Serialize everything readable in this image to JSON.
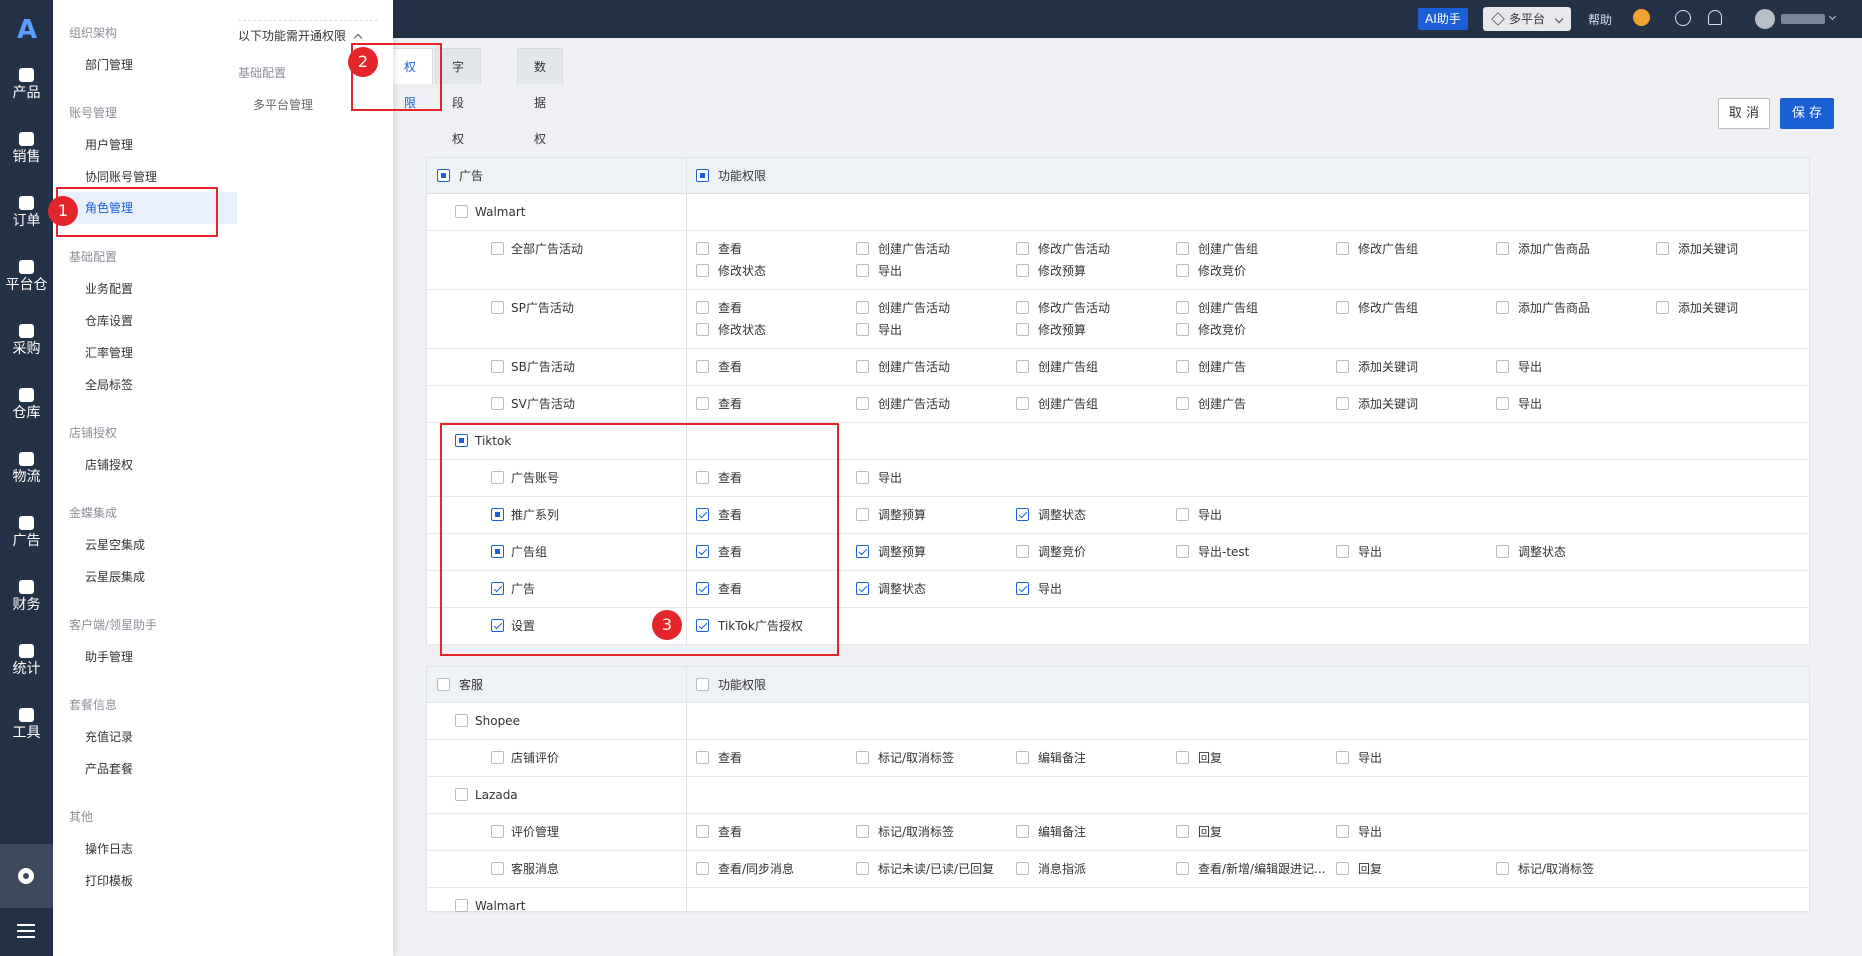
{
  "app": {
    "logo": "A"
  },
  "rail": {
    "items": [
      {
        "label": "产品",
        "icon": "product-icon"
      },
      {
        "label": "销售",
        "icon": "sales-icon"
      },
      {
        "label": "订单",
        "icon": "order-icon"
      },
      {
        "label": "平台仓",
        "icon": "platform-warehouse-icon"
      },
      {
        "label": "采购",
        "icon": "cart-icon"
      },
      {
        "label": "仓库",
        "icon": "warehouse-icon"
      },
      {
        "label": "物流",
        "icon": "truck-icon"
      },
      {
        "label": "广告",
        "icon": "ad-icon"
      },
      {
        "label": "财务",
        "icon": "finance-icon"
      },
      {
        "label": "统计",
        "icon": "pie-chart-icon"
      },
      {
        "label": "工具",
        "icon": "wrench-icon"
      }
    ]
  },
  "topbar": {
    "ai_label": "AI助手",
    "platform_label": "多平台",
    "help_label": "帮助"
  },
  "drawer": {
    "groups": [
      {
        "title": "组织架构",
        "items": [
          "部门管理"
        ]
      },
      {
        "title": "账号管理",
        "items": [
          "用户管理",
          "协同账号管理",
          "角色管理"
        ]
      },
      {
        "title": "基础配置",
        "items": [
          "业务配置",
          "仓库设置",
          "汇率管理",
          "全局标签"
        ]
      },
      {
        "title": "店铺授权",
        "items": [
          "店铺授权"
        ]
      },
      {
        "title": "金蝶集成",
        "items": [
          "云星空集成",
          "云星辰集成"
        ]
      },
      {
        "title": "客户端/领星助手",
        "items": [
          "助手管理"
        ]
      },
      {
        "title": "套餐信息",
        "items": [
          "充值记录",
          "产品套餐"
        ]
      },
      {
        "title": "其他",
        "items": [
          "操作日志",
          "打印模板"
        ]
      }
    ],
    "sub": {
      "title": "以下功能需开通权限",
      "group": "基础配置",
      "item": "多平台管理"
    }
  },
  "tabs": [
    "权限",
    "字段权限",
    "数据权限"
  ],
  "actions": {
    "cancel": "取 消",
    "save": "保 存"
  },
  "ads_table": {
    "header_left": "广告",
    "header_right": "功能权限",
    "rows": [
      {
        "level": 1,
        "label": "Walmart",
        "state": "none",
        "perms": []
      },
      {
        "level": 2,
        "label": "全部广告活动",
        "state": "none",
        "perms": [
          [
            "查看",
            0
          ],
          [
            "创建广告活动",
            0
          ],
          [
            "修改广告活动",
            0
          ],
          [
            "创建广告组",
            0
          ],
          [
            "修改广告组",
            0
          ],
          [
            "添加广告商品",
            0
          ],
          [
            "添加关键词",
            0
          ],
          [
            "修改状态",
            0
          ],
          [
            "导出",
            0
          ],
          [
            "修改预算",
            0
          ],
          [
            "修改竞价",
            0
          ]
        ]
      },
      {
        "level": 2,
        "label": "SP广告活动",
        "state": "none",
        "perms": [
          [
            "查看",
            0
          ],
          [
            "创建广告活动",
            0
          ],
          [
            "修改广告活动",
            0
          ],
          [
            "创建广告组",
            0
          ],
          [
            "修改广告组",
            0
          ],
          [
            "添加广告商品",
            0
          ],
          [
            "添加关键词",
            0
          ],
          [
            "修改状态",
            0
          ],
          [
            "导出",
            0
          ],
          [
            "修改预算",
            0
          ],
          [
            "修改竞价",
            0
          ]
        ]
      },
      {
        "level": 2,
        "label": "SB广告活动",
        "state": "none",
        "perms": [
          [
            "查看",
            0
          ],
          [
            "创建广告活动",
            0
          ],
          [
            "创建广告组",
            0
          ],
          [
            "创建广告",
            0
          ],
          [
            "添加关键词",
            0
          ],
          [
            "导出",
            0
          ]
        ]
      },
      {
        "level": 2,
        "label": "SV广告活动",
        "state": "none",
        "perms": [
          [
            "查看",
            0
          ],
          [
            "创建广告活动",
            0
          ],
          [
            "创建广告组",
            0
          ],
          [
            "创建广告",
            0
          ],
          [
            "添加关键词",
            0
          ],
          [
            "导出",
            0
          ]
        ]
      },
      {
        "level": 1,
        "label": "Tiktok",
        "state": "ind",
        "perms": []
      },
      {
        "level": 2,
        "label": "广告账号",
        "state": "none",
        "perms": [
          [
            "查看",
            0
          ],
          [
            "导出",
            0
          ]
        ]
      },
      {
        "level": 2,
        "label": "推广系列",
        "state": "ind",
        "perms": [
          [
            "查看",
            1
          ],
          [
            "调整预算",
            0
          ],
          [
            "调整状态",
            1
          ],
          [
            "导出",
            0
          ]
        ]
      },
      {
        "level": 2,
        "label": "广告组",
        "state": "ind",
        "perms": [
          [
            "查看",
            1
          ],
          [
            "调整预算",
            1
          ],
          [
            "调整竞价",
            0
          ],
          [
            "导出-test",
            0
          ],
          [
            "导出",
            0
          ],
          [
            "调整状态",
            0
          ]
        ]
      },
      {
        "level": 2,
        "label": "广告",
        "state": "chk",
        "perms": [
          [
            "查看",
            1
          ],
          [
            "调整状态",
            1
          ],
          [
            "导出",
            1
          ]
        ]
      },
      {
        "level": 2,
        "label": "设置",
        "state": "chk",
        "perms": [
          [
            "TikTok广告授权",
            1
          ]
        ]
      }
    ]
  },
  "service_table": {
    "header_left": "客服",
    "header_right": "功能权限",
    "rows": [
      {
        "level": 1,
        "label": "Shopee",
        "state": "none",
        "perms": []
      },
      {
        "level": 2,
        "label": "店铺评价",
        "state": "none",
        "perms": [
          [
            "查看",
            0
          ],
          [
            "标记/取消标签",
            0
          ],
          [
            "编辑备注",
            0
          ],
          [
            "回复",
            0
          ],
          [
            "导出",
            0
          ]
        ]
      },
      {
        "level": 1,
        "label": "Lazada",
        "state": "none",
        "perms": []
      },
      {
        "level": 2,
        "label": "评价管理",
        "state": "none",
        "perms": [
          [
            "查看",
            0
          ],
          [
            "标记/取消标签",
            0
          ],
          [
            "编辑备注",
            0
          ],
          [
            "回复",
            0
          ],
          [
            "导出",
            0
          ]
        ]
      },
      {
        "level": 2,
        "label": "客服消息",
        "state": "none",
        "perms": [
          [
            "查看/同步消息",
            0
          ],
          [
            "标记未读/已读/已回复",
            0
          ],
          [
            "消息指派",
            0
          ],
          [
            "查看/新增/编辑跟进记...",
            0
          ],
          [
            "回复",
            0
          ],
          [
            "标记/取消标签",
            0
          ]
        ]
      },
      {
        "level": 1,
        "label": "Walmart",
        "state": "none",
        "perms": []
      }
    ]
  },
  "markers": [
    "1",
    "2",
    "3"
  ],
  "colors": {
    "accent": "#1a5fd6",
    "rail": "#233246",
    "annotation": "#e4252b"
  }
}
